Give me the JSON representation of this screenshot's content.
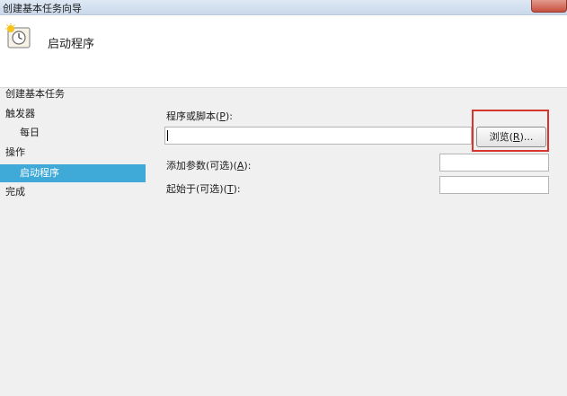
{
  "window": {
    "title": "创建基本任务向导"
  },
  "header": {
    "title": "启动程序",
    "icon": "task-clock-icon"
  },
  "sidebar": {
    "items": [
      {
        "label": "创建基本任务",
        "level": 1,
        "active": false
      },
      {
        "label": "触发器",
        "level": 1,
        "active": false
      },
      {
        "label": "每日",
        "level": 2,
        "active": false
      },
      {
        "label": "操作",
        "level": 1,
        "active": false
      },
      {
        "label": "启动程序",
        "level": 2,
        "active": true
      },
      {
        "label": "完成",
        "level": 1,
        "active": false
      }
    ]
  },
  "form": {
    "program": {
      "label_text": "程序或脚本(",
      "label_key": "P",
      "label_end": "):",
      "value": ""
    },
    "arguments": {
      "label_text": "添加参数(可选)(",
      "label_key": "A",
      "label_end": "):",
      "value": ""
    },
    "start_in": {
      "label_text": "起始于(可选)(",
      "label_key": "T",
      "label_end": "):",
      "value": ""
    },
    "browse": {
      "label_text": "浏览(",
      "label_key": "R",
      "label_end": ")..."
    }
  },
  "colors": {
    "active_nav": "#3fa9d8",
    "highlight": "#d8352e"
  }
}
